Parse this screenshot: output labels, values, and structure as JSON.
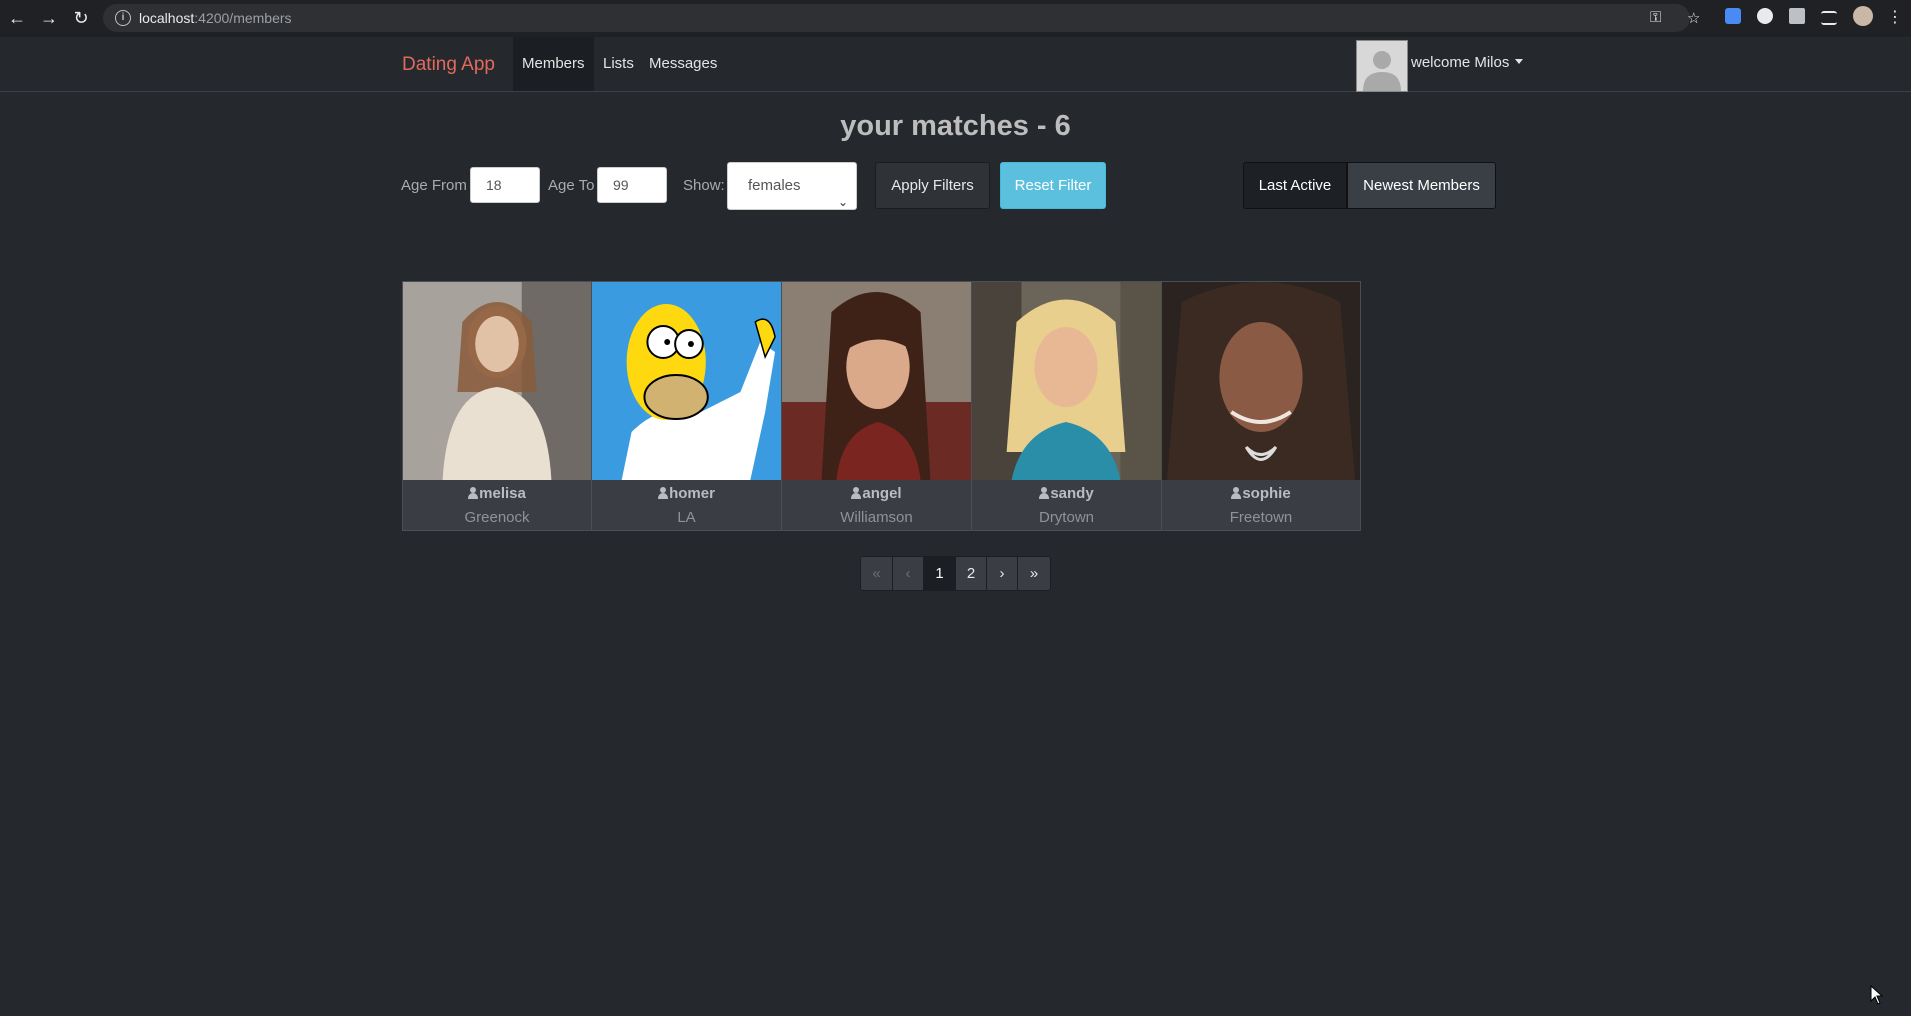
{
  "browser": {
    "url_host": "localhost",
    "url_path": ":4200/members"
  },
  "navbar": {
    "brand": "Dating App",
    "links": [
      {
        "label": "Members"
      },
      {
        "label": "Lists"
      },
      {
        "label": "Messages"
      }
    ],
    "welcome": "welcome Milos"
  },
  "page": {
    "title": "your matches - 6"
  },
  "filters": {
    "age_from_label": "Age From",
    "age_from_value": "18",
    "age_to_label": "Age To",
    "age_to_value": "99",
    "show_label": "Show:",
    "show_value": "females",
    "apply_label": "Apply Filters",
    "reset_label": "Reset Filter",
    "sort_last_active": "Last Active",
    "sort_newest": "Newest Members"
  },
  "members": [
    {
      "name": "melisa",
      "city": "Greenock"
    },
    {
      "name": "homer",
      "city": "LA"
    },
    {
      "name": "angel",
      "city": "Williamson"
    },
    {
      "name": "sandy",
      "city": "Drytown"
    },
    {
      "name": "sophie",
      "city": "Freetown"
    }
  ],
  "pagination": {
    "first": "«",
    "prev": "‹",
    "pages": [
      "1",
      "2"
    ],
    "next": "›",
    "last": "»"
  },
  "colors": {
    "background": "#25292e",
    "brand": "#e06b5c",
    "info_button": "#5bc0de"
  }
}
